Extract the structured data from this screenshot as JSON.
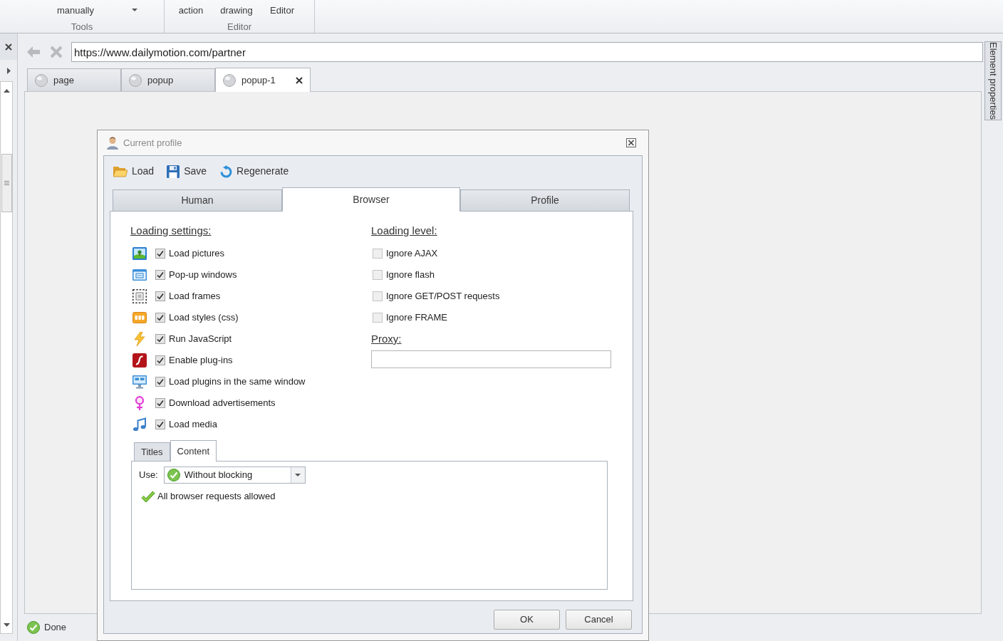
{
  "ribbon": {
    "groups": [
      {
        "label": "Tools",
        "buttons": [
          {
            "kind": "text",
            "label": "manually"
          },
          {
            "kind": "dropdown"
          }
        ]
      },
      {
        "label": "Editor",
        "buttons": [
          {
            "kind": "text",
            "label": "action"
          },
          {
            "kind": "text",
            "label": "drawing"
          },
          {
            "kind": "text",
            "label": "Editor"
          }
        ]
      }
    ]
  },
  "address_bar": {
    "value": "https://www.dailymotion.com/partner"
  },
  "browser_tabs": [
    {
      "label": "page",
      "selected": false
    },
    {
      "label": "popup",
      "selected": false
    },
    {
      "label": "popup-1",
      "selected": true
    }
  ],
  "dialog": {
    "title": "Current profile",
    "toolbar": [
      "Load",
      "Save",
      "Regenerate"
    ],
    "tabs": [
      {
        "label": "Human",
        "selected": false
      },
      {
        "label": "Browser",
        "selected": true
      },
      {
        "label": "Profile",
        "selected": false
      }
    ],
    "loading_settings": {
      "heading": "Loading settings:",
      "options": [
        {
          "label": "Load pictures",
          "checked": true
        },
        {
          "label": "Pop-up windows",
          "checked": true
        },
        {
          "label": "Load frames",
          "checked": true
        },
        {
          "label": "Load styles (css)",
          "checked": true
        },
        {
          "label": "Run JavaScript",
          "checked": true
        },
        {
          "label": "Enable plug-ins",
          "checked": true
        },
        {
          "label": "Load plugins in the same window",
          "checked": true
        },
        {
          "label": "Download advertisements",
          "checked": true
        },
        {
          "label": "Load media",
          "checked": true
        }
      ]
    },
    "loading_level": {
      "heading": "Loading level:",
      "options": [
        {
          "label": "Ignore AJAX",
          "checked": false
        },
        {
          "label": "Ignore flash",
          "checked": false
        },
        {
          "label": "Ignore GET/POST requests",
          "checked": false
        },
        {
          "label": "Ignore FRAME",
          "checked": false
        }
      ]
    },
    "proxy": {
      "label": "Proxy:"
    },
    "subtabs": [
      {
        "label": "Titles",
        "selected": false
      },
      {
        "label": "Content",
        "selected": true
      }
    ],
    "use": {
      "label": "Use:",
      "value": "Without blocking"
    },
    "message": "All browser requests allowed",
    "buttons": [
      "OK",
      "Cancel"
    ]
  },
  "status_bar": {
    "text": "Done"
  },
  "side_panel": {
    "tab": "Element properties"
  }
}
